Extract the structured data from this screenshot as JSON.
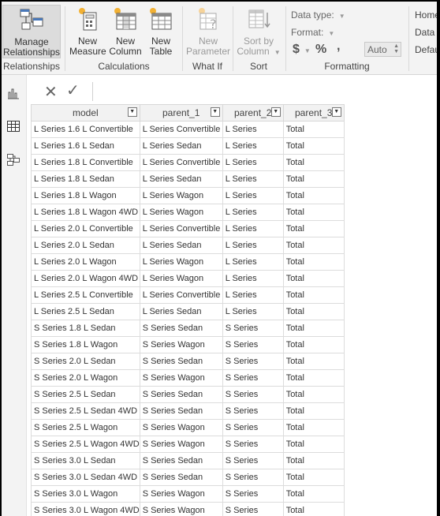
{
  "ribbon": {
    "relationships": {
      "manage_label_1": "Manage",
      "manage_label_2": "Relationships",
      "group_label": "Relationships"
    },
    "calculations": {
      "new_measure_1": "New",
      "new_measure_2": "Measure",
      "new_column_1": "New",
      "new_column_2": "Column",
      "new_table_1": "New",
      "new_table_2": "Table",
      "group_label": "Calculations"
    },
    "whatif": {
      "new_param_1": "New",
      "new_param_2": "Parameter",
      "group_label": "What If"
    },
    "sort": {
      "sort_by_1": "Sort by",
      "sort_by_2": "Column",
      "group_label": "Sort"
    },
    "formatting": {
      "data_type_label": "Data type:",
      "format_label": "Format:",
      "currency_symbol": "$",
      "percent_symbol": "%",
      "comma_symbol": ",",
      "auto_value": "Auto",
      "group_label": "Formatting"
    },
    "properties": {
      "home_label": "Home",
      "data_label": "Data c",
      "default_label": "Defau"
    }
  },
  "formula_bar": {
    "cancel_glyph": "✕",
    "commit_glyph": "✓"
  },
  "table": {
    "columns": [
      "model",
      "parent_1",
      "parent_2",
      "parent_3"
    ],
    "rows": [
      [
        "L Series 1.6 L Convertible",
        "L Series Convertible",
        "L Series",
        "Total"
      ],
      [
        "L Series 1.6 L Sedan",
        "L Series Sedan",
        "L Series",
        "Total"
      ],
      [
        "L Series 1.8 L Convertible",
        "L Series Convertible",
        "L Series",
        "Total"
      ],
      [
        "L Series 1.8 L Sedan",
        "L Series Sedan",
        "L Series",
        "Total"
      ],
      [
        "L Series 1.8 L Wagon",
        "L Series Wagon",
        "L Series",
        "Total"
      ],
      [
        "L Series 1.8 L Wagon 4WD",
        "L Series Wagon",
        "L Series",
        "Total"
      ],
      [
        "L Series 2.0 L Convertible",
        "L Series Convertible",
        "L Series",
        "Total"
      ],
      [
        "L Series 2.0 L Sedan",
        "L Series Sedan",
        "L Series",
        "Total"
      ],
      [
        "L Series 2.0 L Wagon",
        "L Series Wagon",
        "L Series",
        "Total"
      ],
      [
        "L Series 2.0 L Wagon 4WD",
        "L Series Wagon",
        "L Series",
        "Total"
      ],
      [
        "L Series 2.5 L Convertible",
        "L Series Convertible",
        "L Series",
        "Total"
      ],
      [
        "L Series 2.5 L Sedan",
        "L Series Sedan",
        "L Series",
        "Total"
      ],
      [
        "S Series 1.8 L Sedan",
        "S Series Sedan",
        "S Series",
        "Total"
      ],
      [
        "S Series 1.8 L Wagon",
        "S Series Wagon",
        "S Series",
        "Total"
      ],
      [
        "S Series 2.0 L Sedan",
        "S Series Sedan",
        "S Series",
        "Total"
      ],
      [
        "S Series 2.0 L Wagon",
        "S Series Wagon",
        "S Series",
        "Total"
      ],
      [
        "S Series 2.5 L Sedan",
        "S Series Sedan",
        "S Series",
        "Total"
      ],
      [
        "S Series 2.5 L Sedan 4WD",
        "S Series Sedan",
        "S Series",
        "Total"
      ],
      [
        "S Series 2.5 L Wagon",
        "S Series Wagon",
        "S Series",
        "Total"
      ],
      [
        "S Series 2.5 L Wagon 4WD",
        "S Series Wagon",
        "S Series",
        "Total"
      ],
      [
        "S Series 3.0 L Sedan",
        "S Series Sedan",
        "S Series",
        "Total"
      ],
      [
        "S Series 3.0 L Sedan 4WD",
        "S Series Sedan",
        "S Series",
        "Total"
      ],
      [
        "S Series 3.0 L Wagon",
        "S Series Wagon",
        "S Series",
        "Total"
      ],
      [
        "S Series 3.0 L Wagon 4WD",
        "S Series Wagon",
        "S Series",
        "Total"
      ]
    ]
  },
  "colors": {
    "accent_blue": "#2b6cb0",
    "ribbon_bg": "#f3f3f3",
    "header_bg": "#f2f2f2"
  }
}
